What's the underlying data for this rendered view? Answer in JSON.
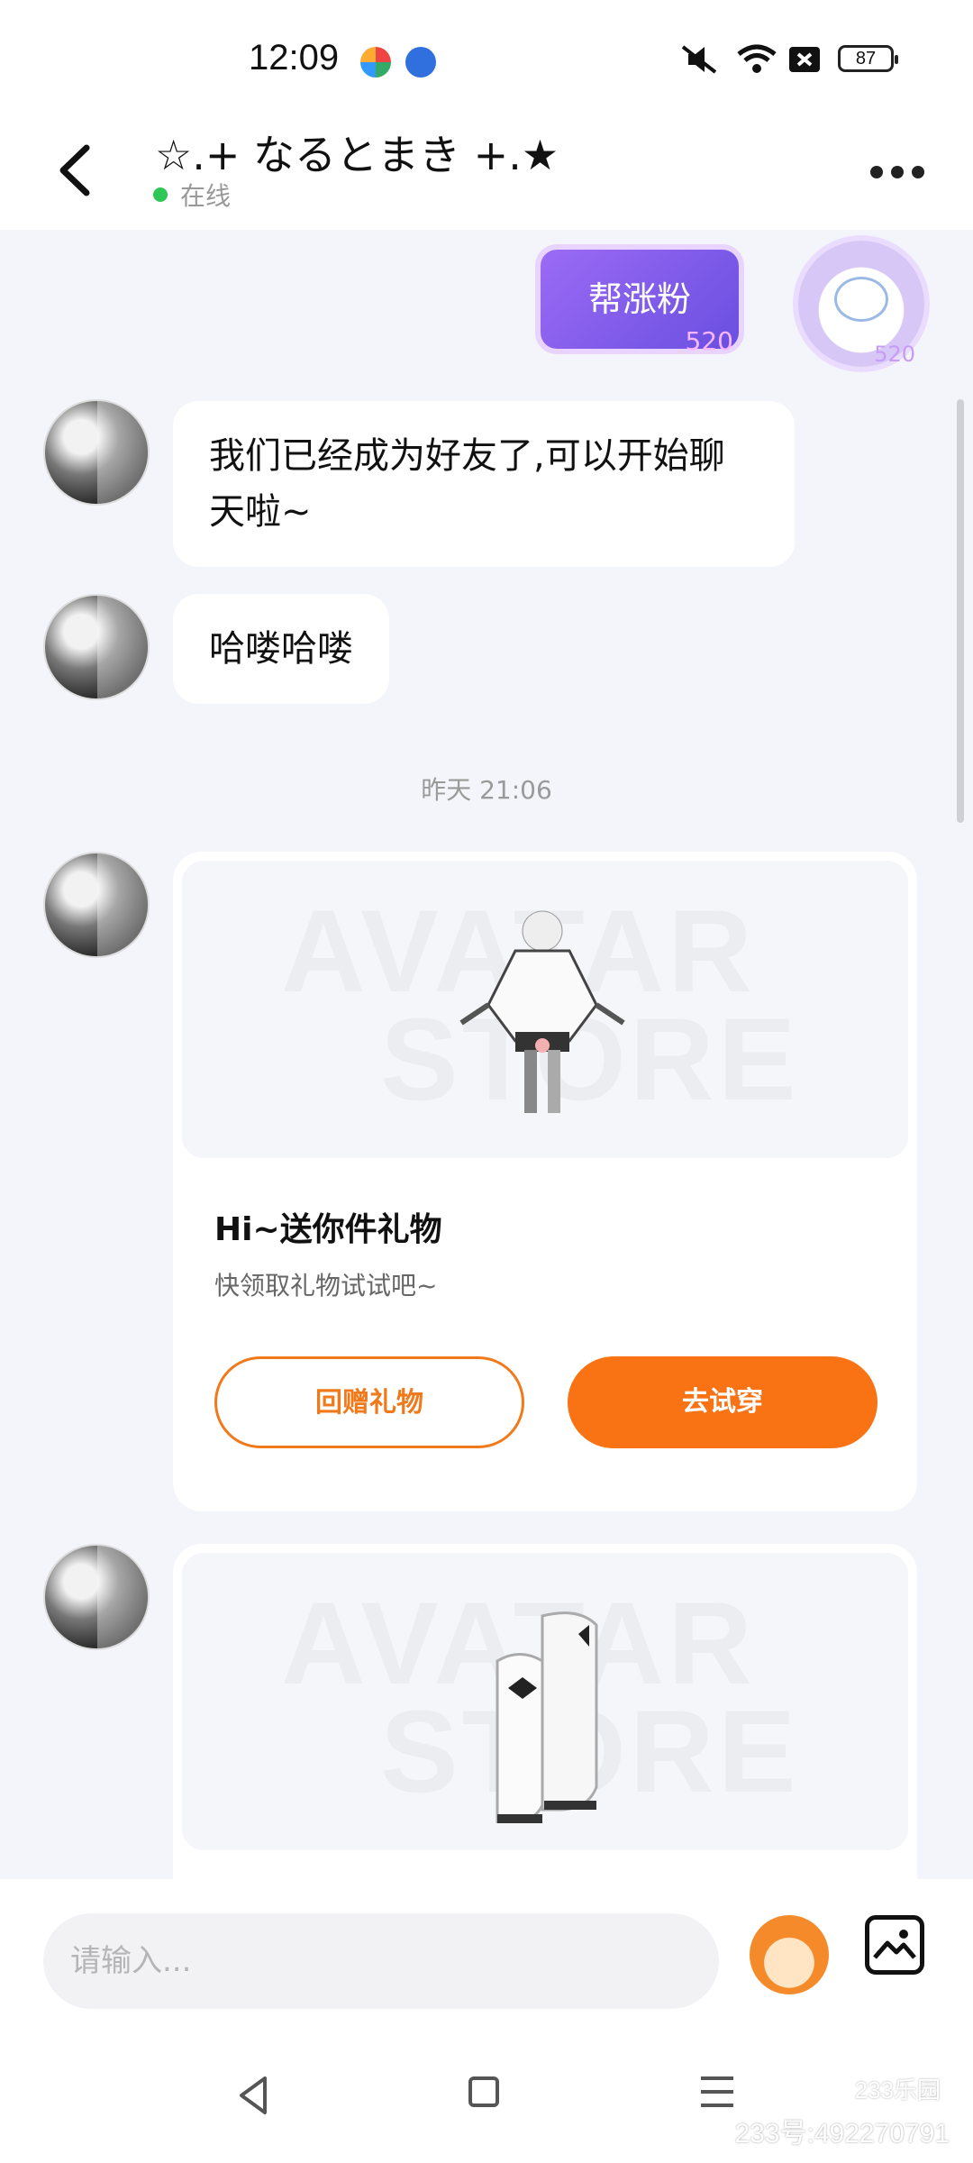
{
  "status_bar": {
    "time": "12:09",
    "battery": "87"
  },
  "header": {
    "title": "☆.+ なるとまき +.★",
    "status": "在线",
    "status_color": "#2ec655"
  },
  "deco": {
    "badge_text": "帮涨粉",
    "badge_number": "520",
    "avatar_number": "520"
  },
  "messages": [
    {
      "text": "我们已经成为好友了,可以开始聊天啦~"
    },
    {
      "text": "哈喽哈喽"
    }
  ],
  "time_divider": "昨天 21:06",
  "gift_card": {
    "watermark_line1": "AVATAR",
    "watermark_line2": "STORE",
    "title": "Hi~送你件礼物",
    "description": "快领取礼物试试吧~",
    "return_gift_label": "回赠礼物",
    "try_on_label": "去试穿",
    "accent_color": "#f97315"
  },
  "gift_card_2": {
    "watermark_line1": "AVATAR",
    "watermark_line2": "STORE"
  },
  "input_bar": {
    "placeholder": "请输入..."
  },
  "nav": {
    "logo": "233乐园",
    "user_id": "233号:492270791"
  },
  "icons": {
    "back": "back-arrow-icon",
    "more": "more-icon",
    "emoji": "emoji-icon",
    "image": "image-icon"
  }
}
